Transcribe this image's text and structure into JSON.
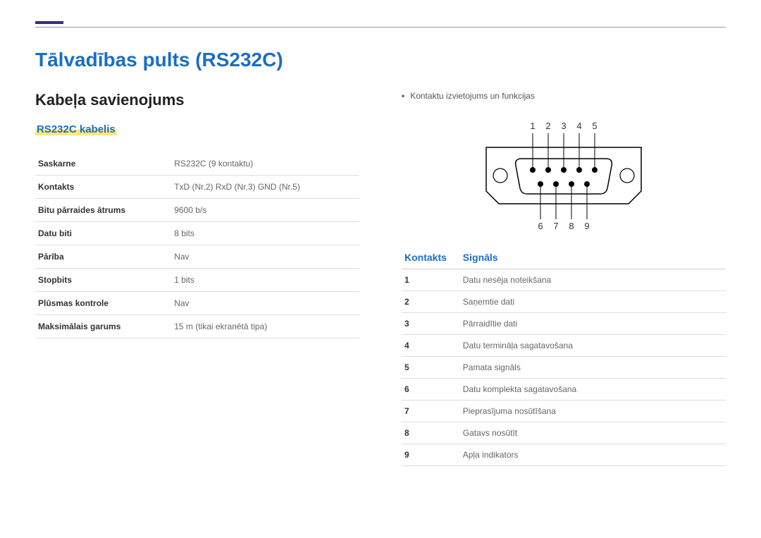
{
  "title": "Tālvadības pults (RS232C)",
  "section": "Kabeļa savienojums",
  "subsection": "RS232C kabelis",
  "spec": [
    {
      "k": "Saskarne",
      "v": "RS232C (9 kontaktu)"
    },
    {
      "k": "Kontakts",
      "v": "TxD (Nr.2) RxD (Nr.3) GND (Nr.5)"
    },
    {
      "k": "Bitu pārraides ātrums",
      "v": "9600 b/s"
    },
    {
      "k": "Datu biti",
      "v": "8 bits"
    },
    {
      "k": "Pārība",
      "v": "Nav"
    },
    {
      "k": "Stopbits",
      "v": "1 bits"
    },
    {
      "k": "Plūsmas kontrole",
      "v": "Nav"
    },
    {
      "k": "Maksimālais garums",
      "v": "15 m (tikai ekranētā tipa)"
    }
  ],
  "note": "Kontaktu izvietojums un funkcijas",
  "pins_top": [
    "1",
    "2",
    "3",
    "4",
    "5"
  ],
  "pins_bottom": [
    "6",
    "7",
    "8",
    "9"
  ],
  "signals_header": {
    "pin": "Kontakts",
    "sig": "Signāls"
  },
  "signals": [
    {
      "pin": "1",
      "sig": "Datu nesēja noteikšana"
    },
    {
      "pin": "2",
      "sig": "Saņemtie dati"
    },
    {
      "pin": "3",
      "sig": "Pārraidītie dati"
    },
    {
      "pin": "4",
      "sig": "Datu termināļa sagatavošana"
    },
    {
      "pin": "5",
      "sig": "Pamata signāls"
    },
    {
      "pin": "6",
      "sig": "Datu komplekta sagatavošana"
    },
    {
      "pin": "7",
      "sig": "Pieprasījuma nosūtīšana"
    },
    {
      "pin": "8",
      "sig": "Gatavs nosūtīt"
    },
    {
      "pin": "9",
      "sig": "Apļa indikators"
    }
  ]
}
